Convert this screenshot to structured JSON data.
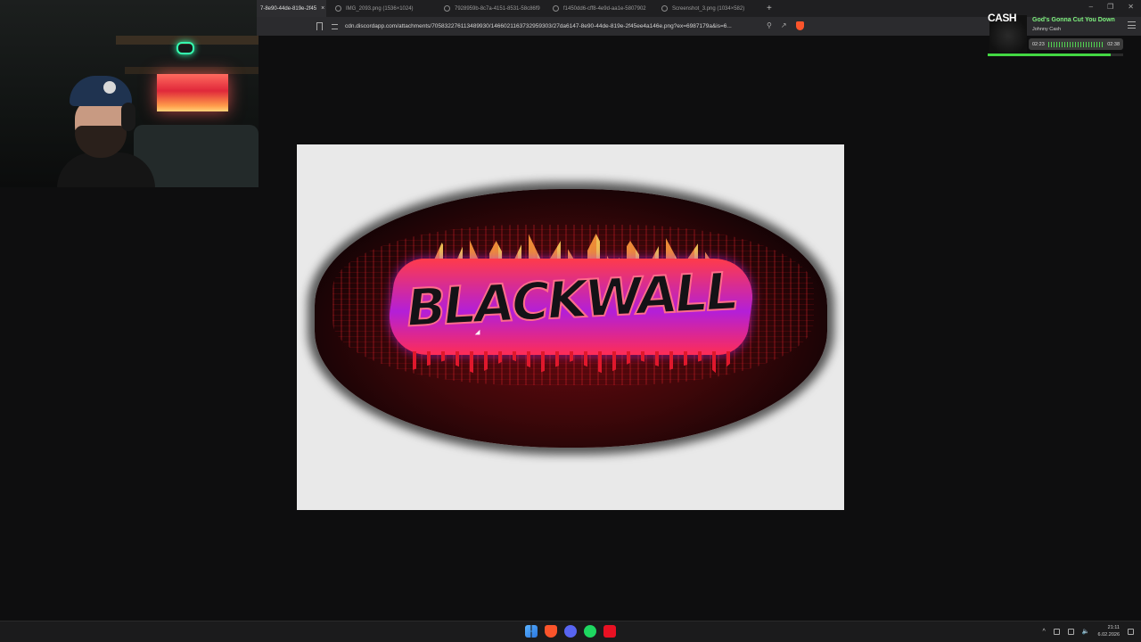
{
  "browser": {
    "tabs": [
      {
        "label": "7-8e90-44de-819e-2f45",
        "active": true
      },
      {
        "label": "IMG_2093.png (1536×1024)",
        "active": false
      },
      {
        "label": "7928959b-8c7a-4151-8531-58c86f9",
        "active": false
      },
      {
        "label": "f1450dd6-cff8-4e9d-aa1e-5807902",
        "active": false
      },
      {
        "label": "Screenshot_3.png (1034×582)",
        "active": false
      }
    ],
    "new_tab": "+",
    "close_tab": "×",
    "url": "cdn.discordapp.com/attachments/705832276113489930/1466021163732959303/27da6147-8e90-44de-819e-2f45ee4a146e.png?ex=6987179a&is=6..."
  },
  "music": {
    "art_text": "CASH",
    "song": "God's Gonna Cut You Down",
    "artist": "Johnny Cash",
    "elapsed": "02:23",
    "duration": "02:38",
    "progress": 0.905
  },
  "image": {
    "text": "BLACKWALL"
  },
  "taskbar": {
    "time": "21:11",
    "date": "6.02.2026"
  },
  "colors": {
    "page_bg": "#0e0e0f",
    "accent_green": "#43d843",
    "brave": "#fb542b"
  }
}
